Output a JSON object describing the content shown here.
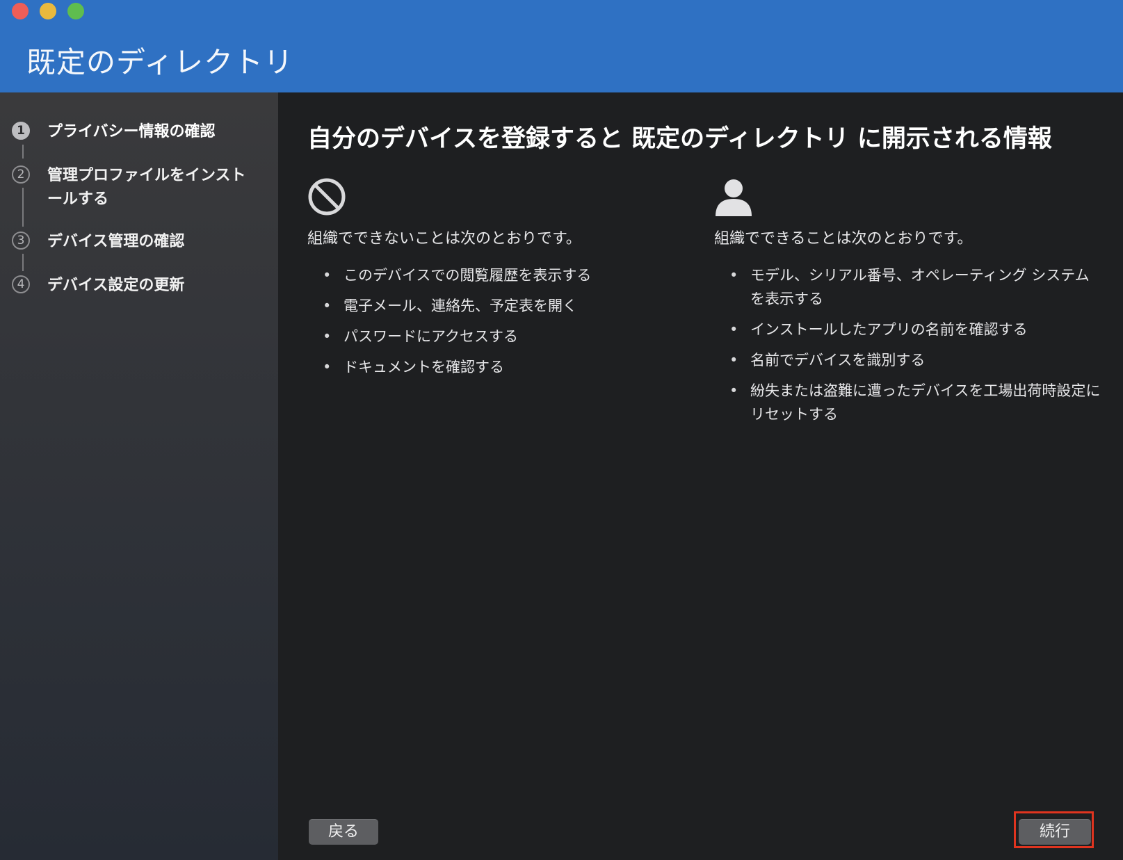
{
  "window": {
    "title": "既定のディレクトリ",
    "controls": {
      "close_color": "#ee5e57",
      "minimize_color": "#e9b93d",
      "zoom_color": "#5fbd4f"
    },
    "titlebar_color": "#2f71c3"
  },
  "sidebar": {
    "steps": [
      {
        "number": "1",
        "label": "プライバシー情報の確認",
        "active": true
      },
      {
        "number": "2",
        "label": "管理プロファイルをインストールする",
        "active": false
      },
      {
        "number": "3",
        "label": "デバイス管理の確認",
        "active": false
      },
      {
        "number": "4",
        "label": "デバイス設定の更新",
        "active": false
      }
    ]
  },
  "main": {
    "heading": "自分のデバイスを登録すると 既定のディレクトリ に開示される情報",
    "cannot": {
      "icon": "prohibited-icon",
      "intro": "組織でできないことは次のとおりです。",
      "items": [
        "このデバイスでの閲覧履歴を表示する",
        "電子メール、連絡先、予定表を開く",
        "パスワードにアクセスする",
        "ドキュメントを確認する"
      ]
    },
    "can": {
      "icon": "person-icon",
      "intro": "組織でできることは次のとおりです。",
      "items": [
        "モデル、シリアル番号、オペレーティング システムを表示する",
        "インストールしたアプリの名前を確認する",
        "名前でデバイスを識別する",
        "紛失または盗難に遭ったデバイスを工場出荷時設定にリセットする"
      ]
    },
    "bullet": "•"
  },
  "footer": {
    "back_label": "戻る",
    "next_label": "続行",
    "highlight_color": "#e0341f"
  }
}
